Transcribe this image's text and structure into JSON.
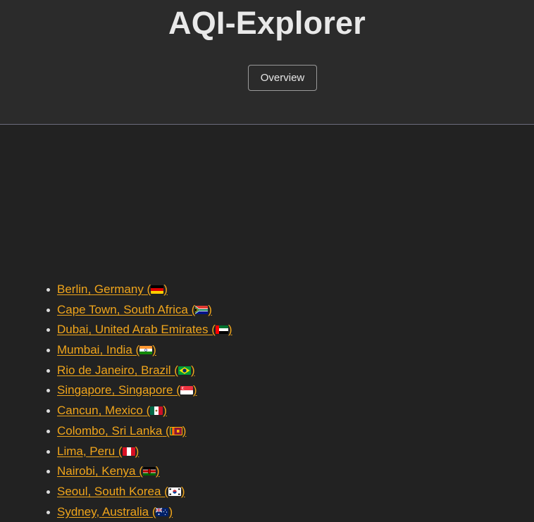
{
  "header": {
    "title": "AQI-Explorer",
    "overview_label": "Overview"
  },
  "cities": [
    {
      "label": "Berlin, Germany",
      "flag": "germany-flag-icon"
    },
    {
      "label": "Cape Town, South Africa",
      "flag": "south-africa-flag-icon"
    },
    {
      "label": "Dubai, United Arab Emirates",
      "flag": "uae-flag-icon"
    },
    {
      "label": "Mumbai, India",
      "flag": "india-flag-icon"
    },
    {
      "label": "Rio de Janeiro, Brazil",
      "flag": "brazil-flag-icon"
    },
    {
      "label": "Singapore, Singapore",
      "flag": "singapore-flag-icon"
    },
    {
      "label": "Cancun, Mexico",
      "flag": "mexico-flag-icon"
    },
    {
      "label": "Colombo, Sri Lanka",
      "flag": "sri-lanka-flag-icon"
    },
    {
      "label": "Lima, Peru",
      "flag": "peru-flag-icon"
    },
    {
      "label": "Nairobi, Kenya",
      "flag": "kenya-flag-icon"
    },
    {
      "label": "Seoul, South Korea",
      "flag": "south-korea-flag-icon"
    },
    {
      "label": "Sydney, Australia",
      "flag": "australia-flag-icon"
    }
  ],
  "colors": {
    "background": "#222222",
    "header_background": "#2b2b2b",
    "link": "#f0a51b",
    "text": "#e6e6e6"
  }
}
